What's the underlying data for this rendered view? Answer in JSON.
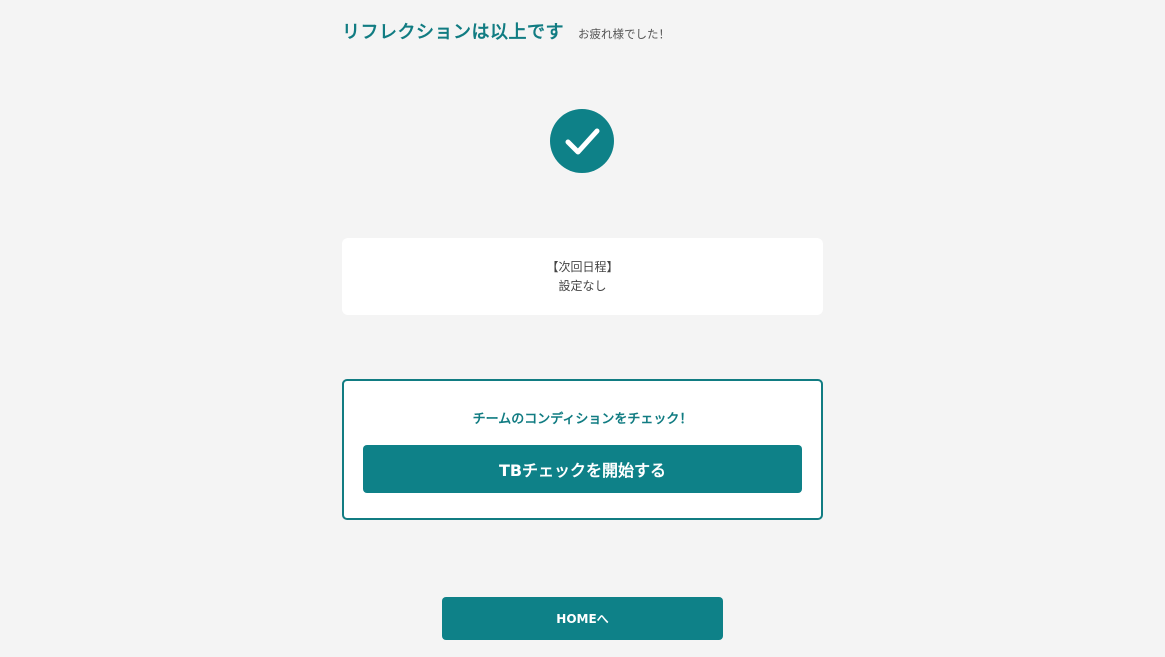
{
  "header": {
    "title": "リフレクションは以上です",
    "subtitle": "お疲れ様でした！"
  },
  "status": {
    "icon": "check-circle-icon",
    "color": "#0e8188"
  },
  "schedule": {
    "label": "【次回日程】",
    "value": "設定なし"
  },
  "team_check": {
    "heading": "チームのコンディションをチェック！",
    "button_label": "TBチェックを開始する"
  },
  "footer": {
    "home_label": "HOMEへ"
  },
  "colors": {
    "accent": "#0e8188",
    "background": "#f4f4f4"
  }
}
